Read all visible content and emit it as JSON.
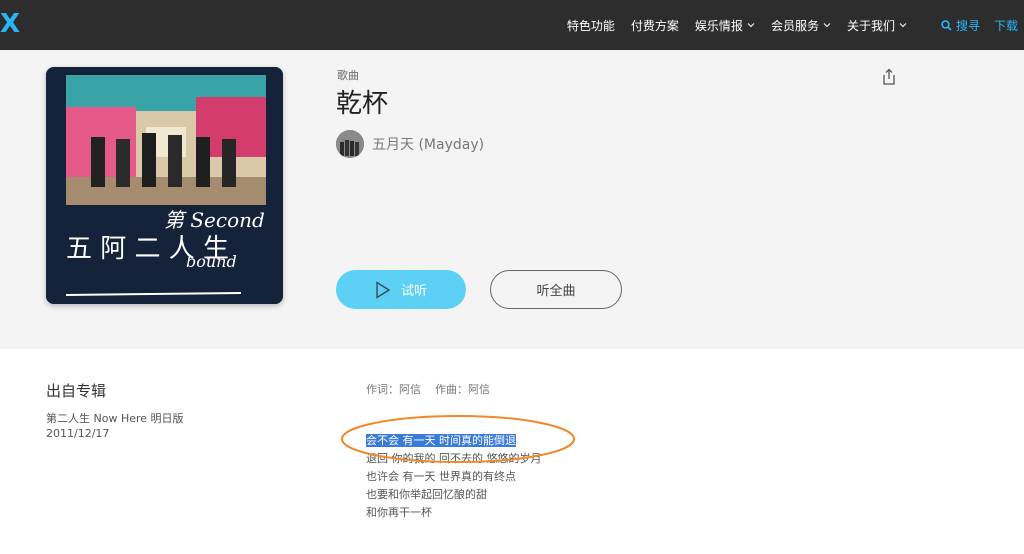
{
  "header": {
    "logo": "X",
    "nav": [
      {
        "label": "特色功能",
        "has_dropdown": false
      },
      {
        "label": "付费方案",
        "has_dropdown": false
      },
      {
        "label": "娱乐情报",
        "has_dropdown": true
      },
      {
        "label": "会员服务",
        "has_dropdown": true
      },
      {
        "label": "关于我们",
        "has_dropdown": true
      }
    ],
    "search_label": "搜寻",
    "download_label": "下载"
  },
  "song": {
    "type_label": "歌曲",
    "title": "乾杯",
    "artist": "五月天 (Mayday)",
    "play_label": "试听",
    "full_label": "听全曲"
  },
  "album": {
    "heading": "出自专辑",
    "name": "第二人生 Now Here 明日版",
    "date": "2011/12/17"
  },
  "credits": {
    "lyricist": "作词：阿信",
    "composer": "作曲：阿信"
  },
  "lyrics": [
    "会不会 有一天 时间真的能倒退",
    "退回 你的我的 回不去的 悠悠的岁月",
    "也许会 有一天 世界真的有终点",
    "也要和你举起回忆酿的甜",
    "和你再干一杯"
  ],
  "colors": {
    "topbar": "#2d2d2d",
    "accent": "#29b6f6",
    "play_button": "#5cd1f5",
    "selection": "#3b7bd8",
    "annotation": "#f0882c"
  }
}
